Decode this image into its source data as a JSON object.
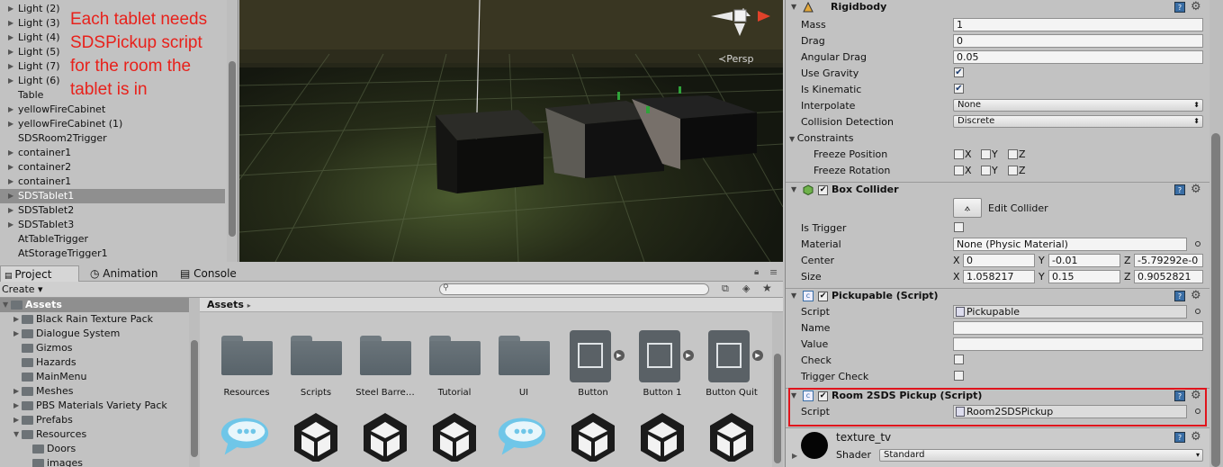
{
  "hierarchy": {
    "items": [
      {
        "label": "Light (2)",
        "expandable": true
      },
      {
        "label": "Light (3)",
        "expandable": true
      },
      {
        "label": "Light (4)",
        "expandable": true
      },
      {
        "label": "Light (5)",
        "expandable": true
      },
      {
        "label": "Light (7)",
        "expandable": true
      },
      {
        "label": "Light (6)",
        "expandable": true
      },
      {
        "label": "Table",
        "expandable": false
      },
      {
        "label": "yellowFireCabinet",
        "expandable": true
      },
      {
        "label": "yellowFireCabinet (1)",
        "expandable": true
      },
      {
        "label": "SDSRoom2Trigger",
        "expandable": false
      },
      {
        "label": "container1",
        "expandable": true
      },
      {
        "label": "container2",
        "expandable": true
      },
      {
        "label": "container1",
        "expandable": true
      },
      {
        "label": "SDSTablet1",
        "expandable": true
      },
      {
        "label": "SDSTablet2",
        "expandable": true
      },
      {
        "label": "SDSTablet3",
        "expandable": true
      },
      {
        "label": "AtTableTrigger",
        "expandable": false
      },
      {
        "label": "AtStorageTrigger1",
        "expandable": false
      }
    ],
    "selected_index": 13
  },
  "annotation": {
    "line1": "Each tablet needs",
    "line2": "SDSPickup script",
    "line3": "for the room the",
    "line4": "tablet is in",
    "color": "#e8211b"
  },
  "scene": {
    "view_mode": "Persp"
  },
  "project": {
    "tabs": {
      "project": "Project",
      "animation": "Animation",
      "console": "Console"
    },
    "create_label": "Create",
    "tree": [
      {
        "label": "Assets",
        "level": 0,
        "expanded": true,
        "selected": true
      },
      {
        "label": "Black Rain Texture Pack",
        "level": 1,
        "expandable": true
      },
      {
        "label": "Dialogue System",
        "level": 1,
        "expandable": true
      },
      {
        "label": "Gizmos",
        "level": 1,
        "expandable": false
      },
      {
        "label": "Hazards",
        "level": 1,
        "expandable": false
      },
      {
        "label": "MainMenu",
        "level": 1,
        "expandable": false
      },
      {
        "label": "Meshes",
        "level": 1,
        "expandable": true
      },
      {
        "label": "PBS Materials Variety Pack",
        "level": 1,
        "expandable": true
      },
      {
        "label": "Prefabs",
        "level": 1,
        "expandable": true
      },
      {
        "label": "Resources",
        "level": 1,
        "expandable": true,
        "expanded": true
      },
      {
        "label": "Doors",
        "level": 2,
        "expandable": false
      },
      {
        "label": "images",
        "level": 2,
        "expandable": false
      }
    ],
    "breadcrumb": "Assets",
    "grid_row1": [
      {
        "label": "Resources",
        "kind": "folder"
      },
      {
        "label": "Scripts",
        "kind": "folder"
      },
      {
        "label": "Steel Barre…",
        "kind": "folder"
      },
      {
        "label": "Tutorial",
        "kind": "folder"
      },
      {
        "label": "UI",
        "kind": "folder"
      },
      {
        "label": "Button",
        "kind": "prefab"
      },
      {
        "label": "Button 1",
        "kind": "prefab"
      },
      {
        "label": "Button Quit",
        "kind": "prefab"
      }
    ],
    "grid_row2": [
      "chat-bubble",
      "unity",
      "unity",
      "unity",
      "chat-bubble",
      "unity",
      "unity",
      "unity"
    ]
  },
  "inspector": {
    "rigidbody": {
      "title": "Rigidbody",
      "mass_label": "Mass",
      "mass": "1",
      "drag_label": "Drag",
      "drag": "0",
      "angular_drag_label": "Angular Drag",
      "angular_drag": "0.05",
      "use_gravity_label": "Use Gravity",
      "use_gravity": true,
      "is_kinematic_label": "Is Kinematic",
      "is_kinematic": true,
      "interpolate_label": "Interpolate",
      "interpolate": "None",
      "collision_label": "Collision Detection",
      "collision": "Discrete",
      "constraints_label": "Constraints",
      "freeze_pos_label": "Freeze Position",
      "freeze_rot_label": "Freeze Rotation",
      "x": "X",
      "y": "Y",
      "z": "Z"
    },
    "box_collider": {
      "title": "Box Collider",
      "edit_label": "Edit Collider",
      "is_trigger_label": "Is Trigger",
      "material_label": "Material",
      "material": "None (Physic Material)",
      "center_label": "Center",
      "center_x": "0",
      "center_y": "-0.01",
      "center_z": "-5.79292e-0",
      "size_label": "Size",
      "size_x": "1.058217",
      "size_y": "0.15",
      "size_z": "0.9052821"
    },
    "pickupable": {
      "title": "Pickupable (Script)",
      "script_label": "Script",
      "script": "Pickupable",
      "name_label": "Name",
      "name": "",
      "value_label": "Value",
      "value": "",
      "check_label": "Check",
      "trigger_check_label": "Trigger Check"
    },
    "room_pickup": {
      "title": "Room 2SDS Pickup (Script)",
      "script_label": "Script",
      "script": "Room2SDSPickup"
    },
    "material": {
      "name": "texture_tv",
      "shader_label": "Shader",
      "shader": "Standard"
    }
  }
}
